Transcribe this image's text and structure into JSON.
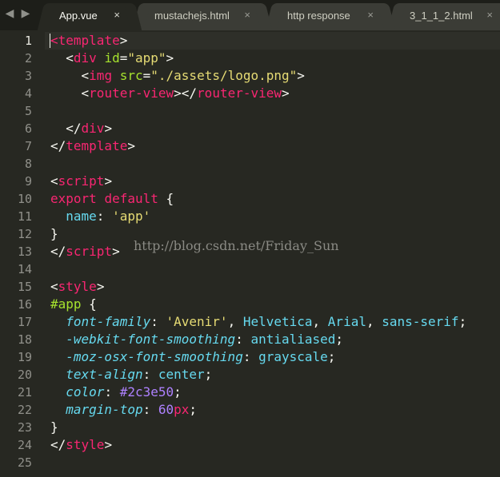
{
  "tabs": [
    {
      "label": "App.vue",
      "active": true
    },
    {
      "label": "mustachejs.html",
      "active": false
    },
    {
      "label": "http response",
      "active": false
    },
    {
      "label": "3_1_1_2.html",
      "active": false
    }
  ],
  "close_glyph": "×",
  "nav": {
    "back": "◀",
    "forward": "▶"
  },
  "current_line": 1,
  "lines": [
    [
      {
        "t": "tag",
        "v": "<"
      },
      {
        "t": "tag",
        "v": "template"
      },
      {
        "t": "punc",
        "v": ">"
      }
    ],
    [
      {
        "t": "punc",
        "v": "  <"
      },
      {
        "t": "tag",
        "v": "div"
      },
      {
        "t": "punc",
        "v": " "
      },
      {
        "t": "attr",
        "v": "id"
      },
      {
        "t": "punc",
        "v": "="
      },
      {
        "t": "str",
        "v": "\"app\""
      },
      {
        "t": "punc",
        "v": ">"
      }
    ],
    [
      {
        "t": "punc",
        "v": "    <"
      },
      {
        "t": "tag",
        "v": "img"
      },
      {
        "t": "punc",
        "v": " "
      },
      {
        "t": "attr",
        "v": "src"
      },
      {
        "t": "punc",
        "v": "="
      },
      {
        "t": "str",
        "v": "\"./assets/logo.png\""
      },
      {
        "t": "punc",
        "v": ">"
      }
    ],
    [
      {
        "t": "punc",
        "v": "    <"
      },
      {
        "t": "tag",
        "v": "router-view"
      },
      {
        "t": "punc",
        "v": "></"
      },
      {
        "t": "tag",
        "v": "router-view"
      },
      {
        "t": "punc",
        "v": ">"
      }
    ],
    [],
    [
      {
        "t": "punc",
        "v": "  </"
      },
      {
        "t": "tag",
        "v": "div"
      },
      {
        "t": "punc",
        "v": ">"
      }
    ],
    [
      {
        "t": "punc",
        "v": "</"
      },
      {
        "t": "tag",
        "v": "template"
      },
      {
        "t": "punc",
        "v": ">"
      }
    ],
    [],
    [
      {
        "t": "punc",
        "v": "<"
      },
      {
        "t": "tag",
        "v": "script"
      },
      {
        "t": "punc",
        "v": ">"
      }
    ],
    [
      {
        "t": "kw",
        "v": "export"
      },
      {
        "t": "punc",
        "v": " "
      },
      {
        "t": "kw",
        "v": "default"
      },
      {
        "t": "punc",
        "v": " {"
      }
    ],
    [
      {
        "t": "punc",
        "v": "  "
      },
      {
        "t": "val",
        "v": "name"
      },
      {
        "t": "punc",
        "v": ": "
      },
      {
        "t": "str",
        "v": "'app'"
      }
    ],
    [
      {
        "t": "punc",
        "v": "}"
      }
    ],
    [
      {
        "t": "punc",
        "v": "</"
      },
      {
        "t": "tag",
        "v": "script"
      },
      {
        "t": "punc",
        "v": ">"
      }
    ],
    [],
    [
      {
        "t": "punc",
        "v": "<"
      },
      {
        "t": "tag",
        "v": "style"
      },
      {
        "t": "punc",
        "v": ">"
      }
    ],
    [
      {
        "t": "sel",
        "v": "#app"
      },
      {
        "t": "punc",
        "v": " {"
      }
    ],
    [
      {
        "t": "punc",
        "v": "  "
      },
      {
        "t": "prop",
        "v": "font-family"
      },
      {
        "t": "punc",
        "v": ": "
      },
      {
        "t": "str",
        "v": "'Avenir'"
      },
      {
        "t": "punc",
        "v": ", "
      },
      {
        "t": "val",
        "v": "Helvetica"
      },
      {
        "t": "punc",
        "v": ", "
      },
      {
        "t": "val",
        "v": "Arial"
      },
      {
        "t": "punc",
        "v": ", "
      },
      {
        "t": "val",
        "v": "sans-serif"
      },
      {
        "t": "punc",
        "v": ";"
      }
    ],
    [
      {
        "t": "punc",
        "v": "  "
      },
      {
        "t": "prop",
        "v": "-webkit-font-smoothing"
      },
      {
        "t": "punc",
        "v": ": "
      },
      {
        "t": "val",
        "v": "antialiased"
      },
      {
        "t": "punc",
        "v": ";"
      }
    ],
    [
      {
        "t": "punc",
        "v": "  "
      },
      {
        "t": "prop",
        "v": "-moz-osx-font-smoothing"
      },
      {
        "t": "punc",
        "v": ": "
      },
      {
        "t": "val",
        "v": "grayscale"
      },
      {
        "t": "punc",
        "v": ";"
      }
    ],
    [
      {
        "t": "punc",
        "v": "  "
      },
      {
        "t": "prop",
        "v": "text-align"
      },
      {
        "t": "punc",
        "v": ": "
      },
      {
        "t": "val",
        "v": "center"
      },
      {
        "t": "punc",
        "v": ";"
      }
    ],
    [
      {
        "t": "punc",
        "v": "  "
      },
      {
        "t": "prop",
        "v": "color"
      },
      {
        "t": "punc",
        "v": ": "
      },
      {
        "t": "num",
        "v": "#2c3e50"
      },
      {
        "t": "punc",
        "v": ";"
      }
    ],
    [
      {
        "t": "punc",
        "v": "  "
      },
      {
        "t": "prop",
        "v": "margin-top"
      },
      {
        "t": "punc",
        "v": ": "
      },
      {
        "t": "num",
        "v": "60"
      },
      {
        "t": "unit",
        "v": "px"
      },
      {
        "t": "punc",
        "v": ";"
      }
    ],
    [
      {
        "t": "punc",
        "v": "}"
      }
    ],
    [
      {
        "t": "punc",
        "v": "</"
      },
      {
        "t": "tag",
        "v": "style"
      },
      {
        "t": "punc",
        "v": ">"
      }
    ],
    []
  ],
  "watermark": "http://blog.csdn.net/Friday_Sun",
  "colors": {
    "background": "#272822",
    "tag": "#f92672",
    "attribute": "#a6e22e",
    "string": "#e6db74",
    "property": "#66d9ef",
    "number": "#ae81ff"
  }
}
